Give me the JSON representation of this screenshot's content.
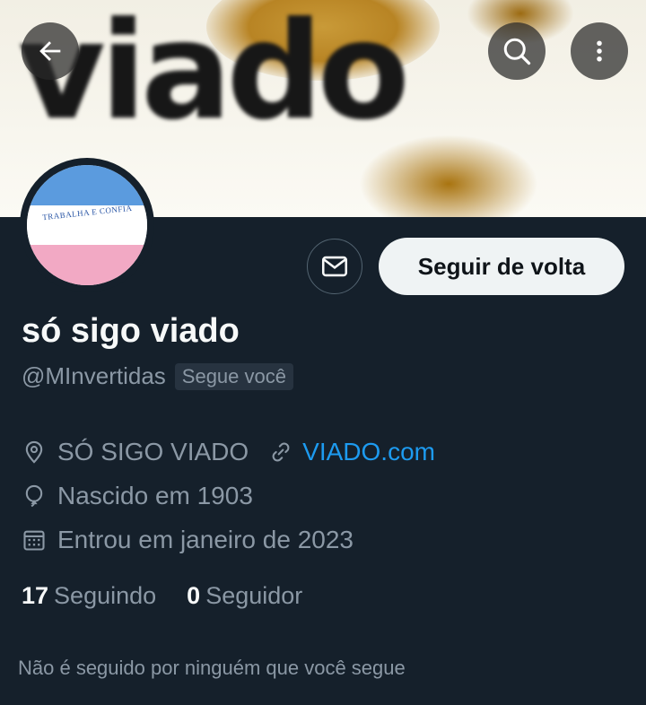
{
  "banner": {
    "text": "viado"
  },
  "avatar": {
    "motto": "TRABALHA E CONFIA"
  },
  "profile": {
    "display_name": "só sigo viado",
    "handle": "@MInvertidas",
    "follows_you_badge": "Segue você",
    "location": "SÓ SIGO VIADO",
    "website": "VIADO.com",
    "birth": "Nascido em 1903",
    "joined": "Entrou em janeiro de 2023"
  },
  "actions": {
    "follow_back_label": "Seguir de volta"
  },
  "stats": {
    "following_count": "17",
    "following_label": "Seguindo",
    "followers_count": "0",
    "followers_label": "Seguidor"
  },
  "footer_note": "Não é seguido por ninguém que você segue",
  "icons": [
    "back-arrow-icon",
    "search-icon",
    "more-vertical-icon",
    "envelope-icon",
    "location-pin-icon",
    "link-icon",
    "balloon-icon",
    "calendar-icon"
  ],
  "colors": {
    "background": "#15202b",
    "link": "#1d9bf0",
    "secondary_text": "#8b98a5",
    "flag_blue": "#5b9bde",
    "flag_pink": "#f2a9c4"
  }
}
